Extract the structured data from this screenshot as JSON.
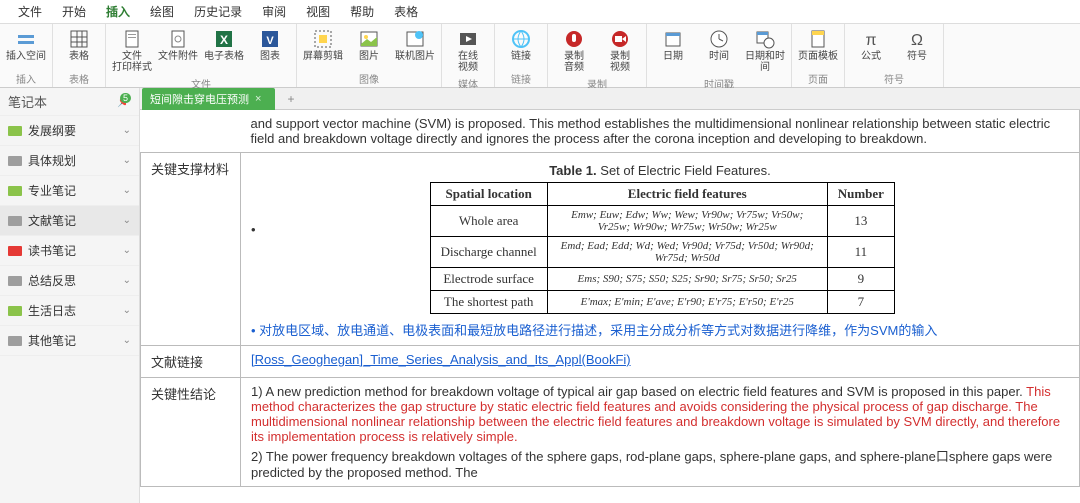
{
  "menubar": [
    "文件",
    "开始",
    "插入",
    "绘图",
    "历史记录",
    "审阅",
    "视图",
    "帮助",
    "表格"
  ],
  "menubar_active": 2,
  "ribbon": {
    "groups": [
      {
        "label": "插入",
        "items": [
          {
            "name": "insert-space",
            "label": "插入空间"
          }
        ]
      },
      {
        "label": "表格",
        "items": [
          {
            "name": "table",
            "label": "表格"
          }
        ]
      },
      {
        "label": "文件",
        "items": [
          {
            "name": "file-print",
            "label": "文件\n打印样式"
          },
          {
            "name": "file-attach",
            "label": "文件附件"
          },
          {
            "name": "spreadsheet",
            "label": "电子表格"
          },
          {
            "name": "diagram",
            "label": "图表"
          }
        ]
      },
      {
        "label": "图像",
        "items": [
          {
            "name": "screenshot",
            "label": "屏幕剪辑"
          },
          {
            "name": "picture",
            "label": "图片"
          },
          {
            "name": "online-picture",
            "label": "联机图片"
          }
        ]
      },
      {
        "label": "媒体",
        "items": [
          {
            "name": "online-video",
            "label": "在线\n视频"
          }
        ]
      },
      {
        "label": "链接",
        "items": [
          {
            "name": "link",
            "label": "链接"
          }
        ]
      },
      {
        "label": "录制",
        "items": [
          {
            "name": "record-audio",
            "label": "录制\n音频"
          },
          {
            "name": "record-video",
            "label": "录制\n视频"
          }
        ]
      },
      {
        "label": "时间戳",
        "items": [
          {
            "name": "date",
            "label": "日期"
          },
          {
            "name": "time",
            "label": "时间"
          },
          {
            "name": "datetime",
            "label": "日期和时间"
          }
        ]
      },
      {
        "label": "页面",
        "items": [
          {
            "name": "page-template",
            "label": "页面模板"
          }
        ]
      },
      {
        "label": "符号",
        "items": [
          {
            "name": "equation",
            "label": "公式"
          },
          {
            "name": "symbol",
            "label": "符号"
          }
        ]
      }
    ]
  },
  "sidebar": {
    "title": "笔记本",
    "badge": "5",
    "items": [
      {
        "label": "发展纲要",
        "color": "#8bc34a"
      },
      {
        "label": "具体规划",
        "color": "#9e9e9e"
      },
      {
        "label": "专业笔记",
        "color": "#8bc34a"
      },
      {
        "label": "文献笔记",
        "color": "#9e9e9e",
        "active": true
      },
      {
        "label": "读书笔记",
        "color": "#e53935"
      },
      {
        "label": "总结反思",
        "color": "#9e9e9e"
      },
      {
        "label": "生活日志",
        "color": "#8bc34a"
      },
      {
        "label": "其他笔记",
        "color": "#9e9e9e"
      }
    ]
  },
  "tab": {
    "title": "短间隙击穿电压预测"
  },
  "doc": {
    "intro": "and support vector machine (SVM) is proposed. This method establishes the multidimensional nonlinear relationship between static electric field and breakdown voltage directly and ignores the process after the corona inception and developing to breakdown.",
    "row1_label": "关键支撑材料",
    "table_caption_b": "Table 1.",
    "table_caption": " Set of Electric Field Features.",
    "th1": "Spatial location",
    "th2": "Electric field features",
    "th3": "Number",
    "r1c1": "Whole area",
    "r1c2": "Emw; Euw; Edw; Ww; Wew; Vr90w; Vr75w; Vr50w; Vr25w; Wr90w; Wr75w; Wr50w; Wr25w",
    "r1c3": "13",
    "r2c1": "Discharge channel",
    "r2c2": "Emd; Ead; Edd; Wd; Wed; Vr90d; Vr75d; Vr50d; Wr90d; Wr75d; Wr50d",
    "r2c3": "11",
    "r3c1": "Electrode surface",
    "r3c2": "Ems; S90; S75; S50; S25; Sr90; Sr75; Sr50; Sr25",
    "r3c3": "9",
    "r4c1": "The shortest path",
    "r4c2": "E'max; E'min; E'ave; E'r90; E'r75; E'r50; E'r25",
    "r4c3": "7",
    "blue_note": "对放电区域、放电通道、电极表面和最短放电路径进行描述，采用主分成分析等方式对数据进行降维，作为SVM的输入",
    "row2_label": "文献链接",
    "file_link": "[Ross_Geoghegan]_Time_Series_Analysis_and_Its_Appl(BookFi)",
    "row3_label": "关键性结论",
    "p1a": "1) A new prediction method for breakdown voltage of typical air gap based on electric field features and SVM is proposed in this paper. ",
    "p1b": "This method characterizes the gap structure by static electric field features and avoids considering the physical process of gap discharge. The multidimensional nonlinear relationship between the electric field features and breakdown voltage is simulated by SVM directly, and therefore its implementation process is relatively simple.",
    "p2": "2) The power frequency breakdown voltages of the sphere gaps, rod-plane gaps, sphere-plane gaps, and sphere-plane口sphere gaps were predicted by the proposed method. The"
  }
}
